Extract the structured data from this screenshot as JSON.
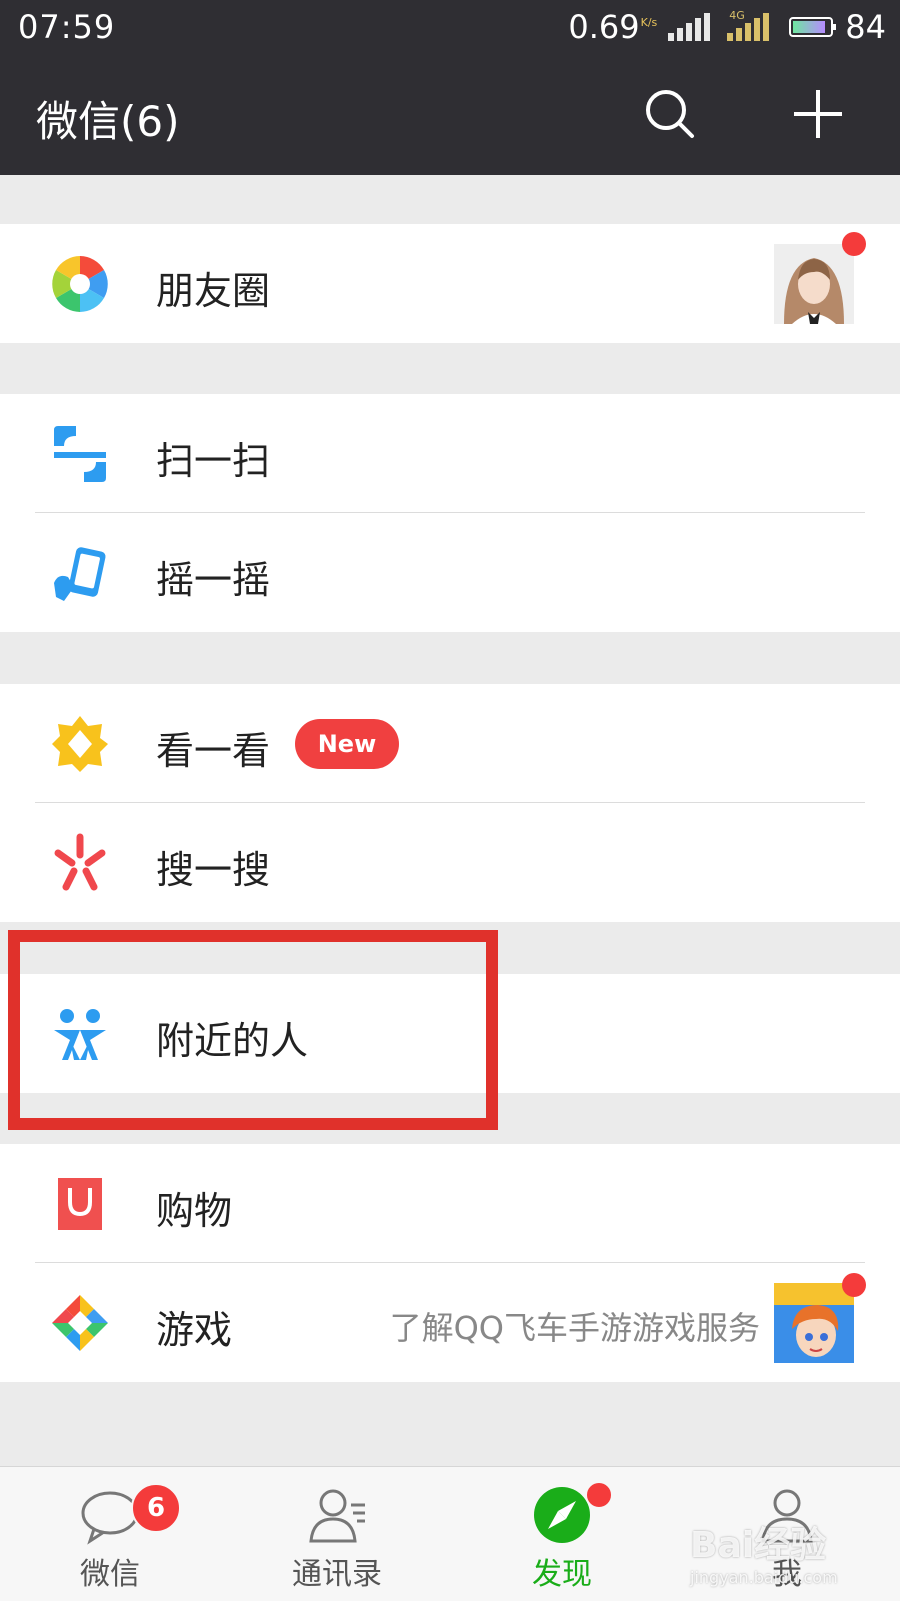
{
  "status_bar": {
    "time": "07:59",
    "net_speed": "0.69",
    "net_unit": "K/s",
    "network_type": "4G",
    "battery": "84"
  },
  "header": {
    "title": "微信(6)",
    "search_icon": "search-icon",
    "add_icon": "plus-icon"
  },
  "discover": {
    "moments": {
      "label": "朋友圈",
      "icon": "moments-aperture-icon"
    },
    "scan": {
      "label": "扫一扫",
      "icon": "scan-icon"
    },
    "shake": {
      "label": "摇一摇",
      "icon": "shake-icon"
    },
    "top_stories": {
      "label": "看一看",
      "badge": "New",
      "icon": "top-stories-icon"
    },
    "search": {
      "label": "搜一搜",
      "icon": "search-sparkle-icon"
    },
    "nearby": {
      "label": "附近的人",
      "icon": "people-nearby-icon"
    },
    "shopping": {
      "label": "购物",
      "icon": "shopping-bag-icon"
    },
    "games": {
      "label": "游戏",
      "hint": "了解QQ飞车手游游戏服务",
      "icon": "games-icon"
    }
  },
  "tabbar": {
    "chats": {
      "label": "微信",
      "badge": "6"
    },
    "contacts": {
      "label": "通讯录"
    },
    "discover": {
      "label": "发现"
    },
    "me": {
      "label": "我"
    }
  },
  "watermark": {
    "main": "Bai经验",
    "sub": "jingyan.baidu.com"
  },
  "colors": {
    "bar": "#2f2e33",
    "accent_green": "#1aad19",
    "badge_red": "#f43b3b",
    "highlight_red": "#e0312b"
  }
}
